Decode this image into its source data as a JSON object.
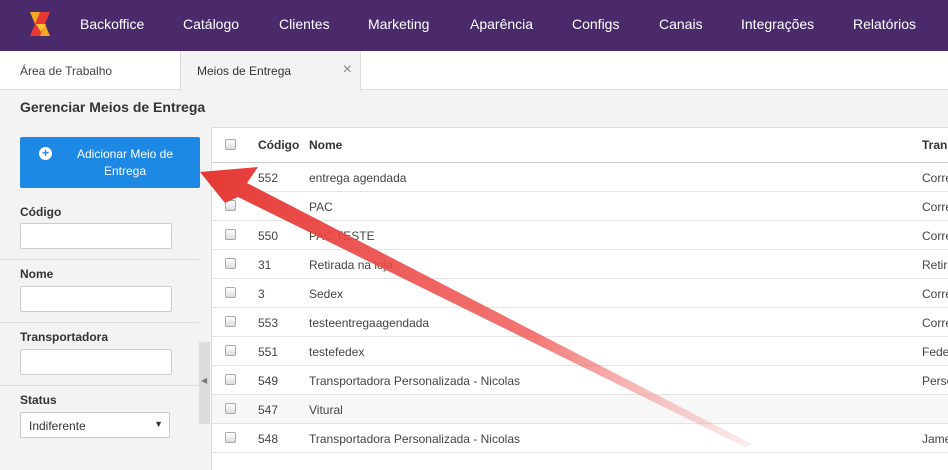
{
  "nav": {
    "logo": "logo-icon",
    "items": [
      "Backoffice",
      "Catálogo",
      "Clientes",
      "Marketing",
      "Aparência",
      "Configs",
      "Canais",
      "Integrações",
      "Relatórios"
    ]
  },
  "tabs": {
    "t1": "Área de Trabalho",
    "t2": "Meios de Entrega",
    "close": "×"
  },
  "page": {
    "title": "Gerenciar Meios de Entrega"
  },
  "sidebar": {
    "add_button": "Adicionar Meio de Entrega",
    "fields": {
      "codigo": "Código",
      "nome": "Nome",
      "transportadora": "Transportadora",
      "status": "Status"
    },
    "status_value": "Indiferente",
    "caret": "▼",
    "collapse": "◀"
  },
  "table": {
    "headers": {
      "code": "Código",
      "name": "Nome",
      "trans": "Transportadora"
    },
    "rows": [
      {
        "code": "552",
        "name": "entrega agendada",
        "trans": "Correios"
      },
      {
        "code": "",
        "name": "PAC",
        "trans": "Correios"
      },
      {
        "code": "550",
        "name": "PAC TESTE",
        "trans": "Correios"
      },
      {
        "code": "31",
        "name": "Retirada na loja",
        "trans": "Retirada"
      },
      {
        "code": "3",
        "name": "Sedex",
        "trans": "Correios"
      },
      {
        "code": "553",
        "name": "testeentregaagendada",
        "trans": "Correios"
      },
      {
        "code": "551",
        "name": "testefedex",
        "trans": "Fedex"
      },
      {
        "code": "549",
        "name": "Transportadora Personalizada - Nicolas",
        "trans": "Personalizada"
      },
      {
        "code": "547",
        "name": "Vitural",
        "trans": ""
      },
      {
        "code": "548",
        "name": "Transportadora Personalizada - Nicolas",
        "trans": "Jamef"
      }
    ]
  },
  "colors": {
    "topbar": "#4a2a6b",
    "accent": "#1e88e5",
    "arrow": "#e53935"
  }
}
